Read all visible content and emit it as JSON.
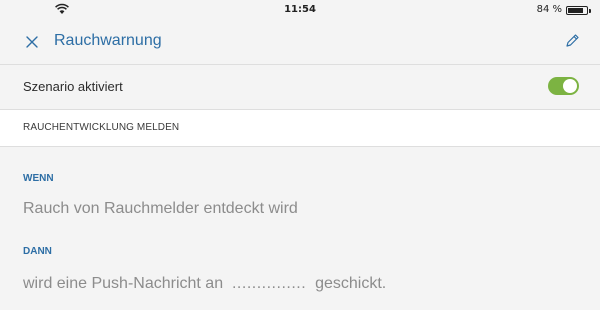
{
  "status_bar": {
    "time": "11:54",
    "battery": "84 %",
    "battery_level": 0.84,
    "icons": [
      "wifi-icon",
      "battery-icon"
    ]
  },
  "nav": {
    "close_icon": "close-icon",
    "title": "Rauchwarnung",
    "edit_icon": "pencil-icon",
    "accent_color": "#2d6ea5"
  },
  "scenario": {
    "label": "Szenario aktiviert",
    "enabled": true,
    "toggle_color": "#7cb342"
  },
  "section": {
    "title": "RAUCHENTWICKLUNG MELDEN"
  },
  "rule": {
    "when_label": "WENN",
    "when_text": "Rauch von Rauchmelder entdeckt wird",
    "then_label": "DANN",
    "then_prefix": "wird eine Push-Nachricht an",
    "then_placeholder": "...............",
    "then_suffix": "geschickt."
  }
}
